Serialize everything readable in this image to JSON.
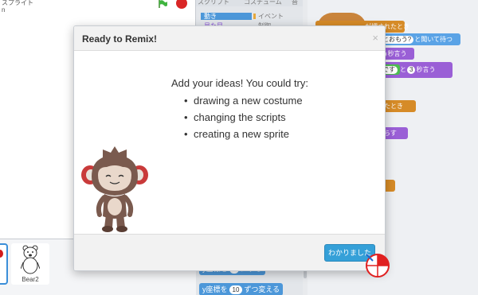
{
  "stage": {
    "title": "スプライト",
    "user": "n"
  },
  "sprites": {
    "bear_name": "Bear2"
  },
  "tabs": {
    "scripts": "スクリプト",
    "costumes": "コスチューム",
    "sounds": "音"
  },
  "palette": {
    "categories": {
      "motion": "動き",
      "looks": "見た目",
      "events": "イベント",
      "control": "制御"
    },
    "blocks": {
      "turn_label": "y座標を",
      "turn_value": "10",
      "turn_suffix": "ずつ変える",
      "set_label": "y座標を",
      "set_value": "0",
      "set_suffix": "にする"
    }
  },
  "scripts_area": {
    "hat_text": "が押されたとき",
    "ask_text": "なんだとおもう?",
    "ask_suffix": "と聞いて待つ",
    "say_num": "2",
    "say_suffix": "秒言う",
    "answer_text": "です",
    "and_text": "と",
    "secs": "3",
    "say2_suffix": "秒言う",
    "clicked_text": "ったとき",
    "sound_text": "鳴らす",
    "misc_text": "る"
  },
  "modal": {
    "title": "Ready to Remix!",
    "close": "×",
    "lead": "Add your ideas! You could try:",
    "items": [
      "drawing a new costume",
      "changing the scripts",
      "creating a new sprite"
    ],
    "ok_button": "わかりました"
  },
  "colors": {
    "motion": "#4c97d9",
    "events": "#d68b27",
    "looks": "#9a5fd6",
    "ok_button": "#35a0d8",
    "stop": "#d92626"
  }
}
